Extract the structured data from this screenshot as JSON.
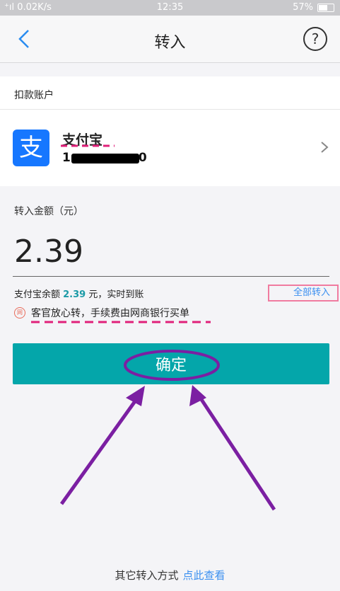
{
  "status_bar": {
    "signal": "⁺ıl 0.02K/s",
    "time": "12:35",
    "battery": "57%"
  },
  "header": {
    "title": "转入",
    "help_label": "?"
  },
  "debit_account": {
    "section_label": "扣款账户",
    "name": "支付宝",
    "number_prefix": "1",
    "number_suffix": "0",
    "logo_text": "支"
  },
  "amount": {
    "label": "转入金额（元）",
    "value": "2.39",
    "balance_prefix": "支付宝余额 ",
    "balance_value": "2.39",
    "balance_suffix": " 元，实时到账",
    "transfer_all": "全部转入",
    "notice": "客官放心转，手续费由网商银行买单",
    "notice_icon_text": "网"
  },
  "confirm_label": "确定",
  "footer": {
    "text": "其它转入方式",
    "link": "点此查看"
  },
  "colors": {
    "accent": "#04a6aa",
    "link": "#3a8ff0",
    "annotation_pink": "#e0207a",
    "annotation_purple": "#7b1fa2"
  }
}
